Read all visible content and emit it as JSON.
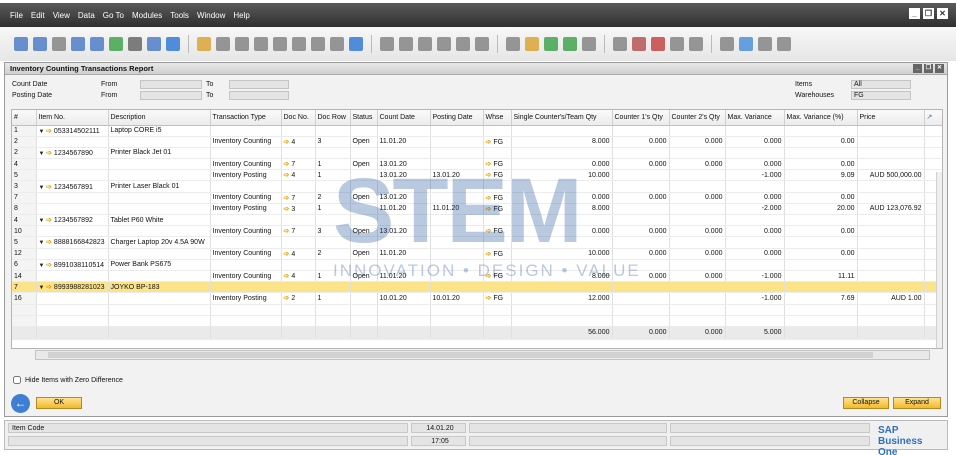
{
  "menu": [
    "File",
    "Edit",
    "View",
    "Data",
    "Go To",
    "Modules",
    "Tools",
    "Window",
    "Help"
  ],
  "report_title": "Inventory Counting Transactions Report",
  "filters": {
    "count_date": "Count Date",
    "posting_date": "Posting Date",
    "from": "From",
    "to": "To",
    "items": "Items",
    "items_value": "All",
    "warehouses": "Warehouses",
    "warehouses_value": "FG"
  },
  "columns": [
    "#",
    "Item No.",
    "Description",
    "Transaction Type",
    "Doc No.",
    "Doc Row",
    "Status",
    "Count Date",
    "Posting Date",
    "Whse",
    "Single Counter's/Team Qty",
    "Counter 1's Qty",
    "Counter 2's Qty",
    "Max. Variance",
    "Max. Variance (%)",
    "Price"
  ],
  "rows": [
    {
      "n": "1",
      "item": "053314502111",
      "desc": "Laptop CORE i5",
      "group": true
    },
    {
      "n": "2",
      "type": "Inventory Counting",
      "doc": "4",
      "row": "3",
      "status": "Open",
      "cdate": "11.01.20",
      "pdate": "",
      "whse": "FG",
      "single": "8.000",
      "c1": "0.000",
      "c2": "0.000",
      "mv": "0.000",
      "mvp": "0.00",
      "price": ""
    },
    {
      "n": "2",
      "item": "1234567890",
      "desc": "Printer Black Jet 01",
      "group": true
    },
    {
      "n": "4",
      "type": "Inventory Counting",
      "doc": "7",
      "row": "1",
      "status": "Open",
      "cdate": "13.01.20",
      "pdate": "",
      "whse": "FG",
      "single": "0.000",
      "c1": "0.000",
      "c2": "0.000",
      "mv": "0.000",
      "mvp": "0.00",
      "price": ""
    },
    {
      "n": "5",
      "type": "Inventory Posting",
      "doc": "4",
      "row": "1",
      "status": "",
      "cdate": "13.01.20",
      "pdate": "13.01.20",
      "whse": "FG",
      "single": "10.000",
      "c1": "",
      "c2": "",
      "mv": "-1.000",
      "mvp": "9.09",
      "price": "AUD 500,000.00"
    },
    {
      "n": "3",
      "item": "1234567891",
      "desc": "Printer Laser Black 01",
      "group": true
    },
    {
      "n": "7",
      "type": "Inventory Counting",
      "doc": "7",
      "row": "2",
      "status": "Open",
      "cdate": "13.01.20",
      "pdate": "",
      "whse": "FG",
      "single": "0.000",
      "c1": "0.000",
      "c2": "0.000",
      "mv": "0.000",
      "mvp": "0.00",
      "price": ""
    },
    {
      "n": "8",
      "type": "Inventory Posting",
      "doc": "3",
      "row": "1",
      "status": "",
      "cdate": "11.01.20",
      "pdate": "11.01.20",
      "whse": "FG",
      "single": "8.000",
      "c1": "",
      "c2": "",
      "mv": "-2.000",
      "mvp": "20.00",
      "price": "AUD 123,076.92"
    },
    {
      "n": "4",
      "item": "1234567892",
      "desc": "Tablet P60 White",
      "group": true
    },
    {
      "n": "10",
      "type": "Inventory Counting",
      "doc": "7",
      "row": "3",
      "status": "Open",
      "cdate": "13.01.20",
      "pdate": "",
      "whse": "FG",
      "single": "0.000",
      "c1": "0.000",
      "c2": "0.000",
      "mv": "0.000",
      "mvp": "0.00",
      "price": ""
    },
    {
      "n": "5",
      "item": "8888166842823",
      "desc": "Charger Laptop 20v 4.5A 90W",
      "group": true
    },
    {
      "n": "12",
      "type": "Inventory Counting",
      "doc": "4",
      "row": "2",
      "status": "Open",
      "cdate": "11.01.20",
      "pdate": "",
      "whse": "FG",
      "single": "10.000",
      "c1": "0.000",
      "c2": "0.000",
      "mv": "0.000",
      "mvp": "0.00",
      "price": ""
    },
    {
      "n": "6",
      "item": "8991038110514",
      "desc": "Power Bank PS675",
      "group": true
    },
    {
      "n": "14",
      "type": "Inventory Counting",
      "doc": "4",
      "row": "1",
      "status": "Open",
      "cdate": "11.01.20",
      "pdate": "",
      "whse": "FG",
      "single": "8.000",
      "c1": "0.000",
      "c2": "0.000",
      "mv": "-1.000",
      "mvp": "11.11",
      "price": ""
    },
    {
      "n": "7",
      "item": "8993988281023",
      "desc": "JOYKO BP-183",
      "group": true,
      "highlight": true
    },
    {
      "n": "16",
      "type": "Inventory Posting",
      "doc": "2",
      "row": "1",
      "status": "",
      "cdate": "10.01.20",
      "pdate": "10.01.20",
      "whse": "FG",
      "single": "12.000",
      "c1": "",
      "c2": "",
      "mv": "-1.000",
      "mvp": "7.69",
      "price": "AUD 1.00"
    }
  ],
  "totals": {
    "single": "56.000",
    "c1": "0.000",
    "c2": "0.000",
    "mv": "5.000"
  },
  "hide_zero_label": "Hide Items with Zero Difference",
  "buttons": {
    "ok": "OK",
    "collapse": "Collapse",
    "expand": "Expand"
  },
  "status": {
    "item_code": "Item Code",
    "date": "14.01.20",
    "time": "17:05"
  },
  "watermark": "STEM",
  "watermark_tagline": "INNOVATION • DESIGN • VALUE",
  "brand": "SAP Business One"
}
